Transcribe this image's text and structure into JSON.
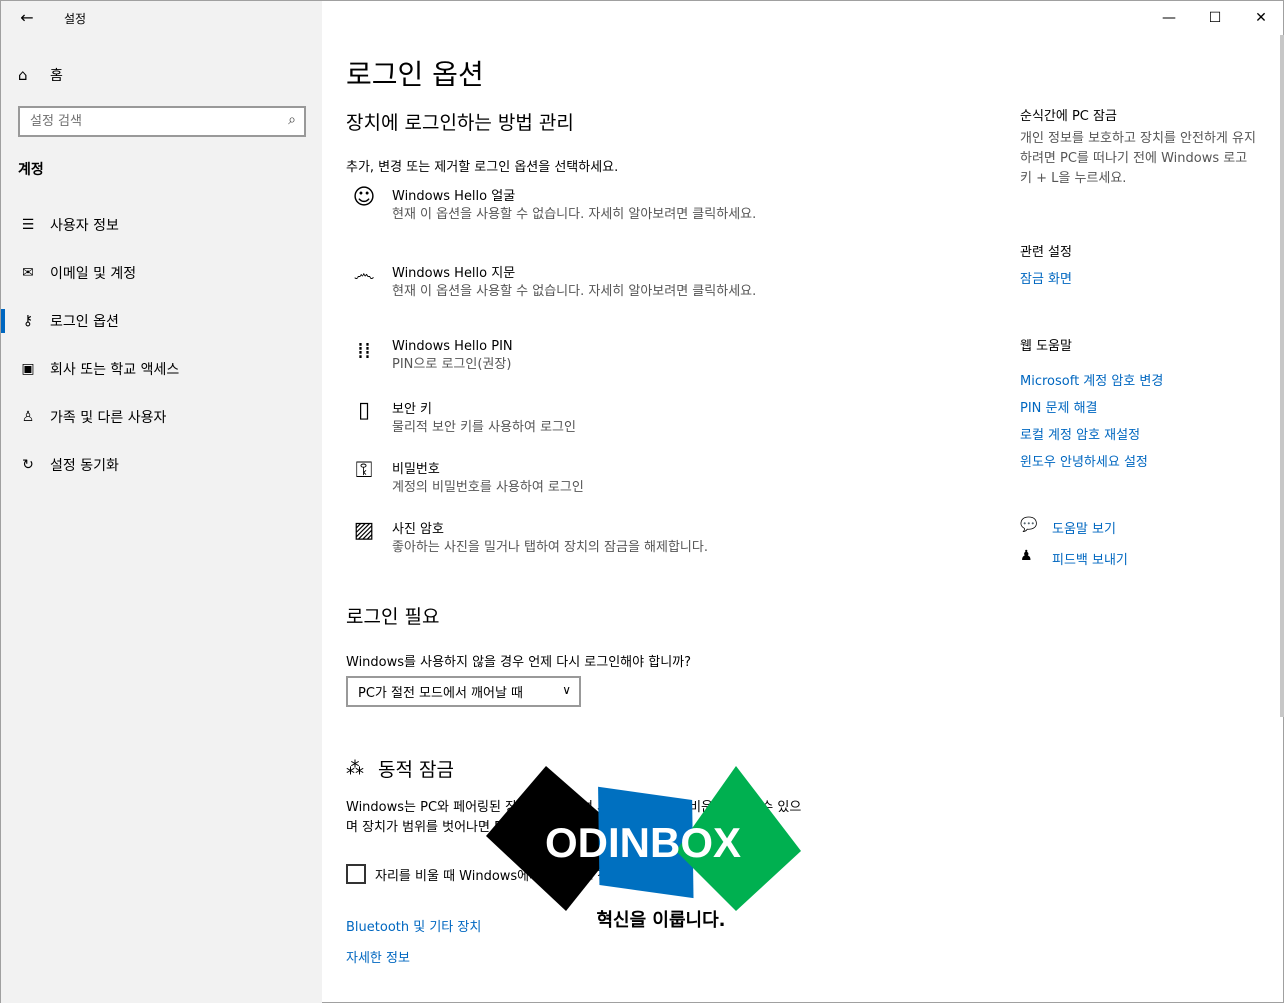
{
  "window": {
    "title": "설정"
  },
  "sidebar": {
    "home_label": "홈",
    "search_placeholder": "설정 검색",
    "section": "계정",
    "items": [
      {
        "label": "사용자 정보",
        "icon": "user-info-icon"
      },
      {
        "label": "이메일 및 계정",
        "icon": "mail-icon"
      },
      {
        "label": "로그인 옵션",
        "icon": "key-icon",
        "active": true
      },
      {
        "label": "회사 또는 학교 액세스",
        "icon": "briefcase-icon"
      },
      {
        "label": "가족 및 다른 사용자",
        "icon": "person-add-icon"
      },
      {
        "label": "설정 동기화",
        "icon": "sync-icon"
      }
    ]
  },
  "main": {
    "title": "로그인 옵션",
    "subtitle": "장치에 로그인하는 방법 관리",
    "description": "추가, 변경 또는 제거할 로그인 옵션을 선택하세요.",
    "options": [
      {
        "title": "Windows Hello 얼굴",
        "sub": "현재 이 옵션을 사용할 수 없습니다. 자세히 알아보려면 클릭하세요.",
        "icon": "face-icon"
      },
      {
        "title": "Windows Hello 지문",
        "sub": "현재 이 옵션을 사용할 수 없습니다. 자세히 알아보려면 클릭하세요.",
        "icon": "fingerprint-icon"
      },
      {
        "title": "Windows Hello PIN",
        "sub": "PIN으로 로그인(권장)",
        "icon": "pin-keypad-icon"
      },
      {
        "title": "보안 키",
        "sub": "물리적 보안 키를 사용하여 로그인",
        "icon": "usb-key-icon"
      },
      {
        "title": "비밀번호",
        "sub": "계정의 비밀번호를 사용하여 로그인",
        "icon": "password-key-icon"
      },
      {
        "title": "사진 암호",
        "sub": "좋아하는 사진을 밀거나 탭하여 장치의 잠금을 해제합니다.",
        "icon": "picture-icon"
      }
    ],
    "require_title": "로그인 필요",
    "require_question": "Windows를 사용하지 않을 경우 언제 다시 로그인해야 합니까?",
    "require_value": "PC가 절전 모드에서 깨어날 때",
    "dynamic_title": "동적 잠금",
    "dynamic_text": "Windows는 PC와 페어링된 장치를 사용하여 사용자가 자리를 비운 때를 알 수 있으며 장치가 범위를 벗어나면 PC를 잠급니다.",
    "dynamic_checkbox": "자리를 비울 때 Windows에서 자동으로 장치 잠금 허용",
    "links": [
      "Bluetooth 및 기타 장치",
      "자세한 정보"
    ]
  },
  "right": {
    "lock_title": "순식간에 PC 잠금",
    "lock_desc": "개인 정보를 보호하고 장치를 안전하게 유지하려면 PC를 떠나기 전에 Windows 로고 키 + L을 누르세요.",
    "related_title": "관련 설정",
    "related_link": "잠금 화면",
    "web_help_title": "웹 도움말",
    "web_links": [
      "Microsoft 계정 암호 변경",
      "PIN 문제 해결",
      "로컬 계정 암호 재설정",
      "윈도우 안녕하세요 설정"
    ],
    "get_help": "도움말 보기",
    "feedback": "피드백 보내기"
  },
  "watermark": {
    "brand": "ODINBOX",
    "tagline": "혁신을 이룹니다.",
    "colors": [
      "#000000",
      "#0070c0",
      "#00b050"
    ]
  },
  "colors": {
    "accent": "#0067c0",
    "sidebar_bg": "#f2f2f2"
  }
}
